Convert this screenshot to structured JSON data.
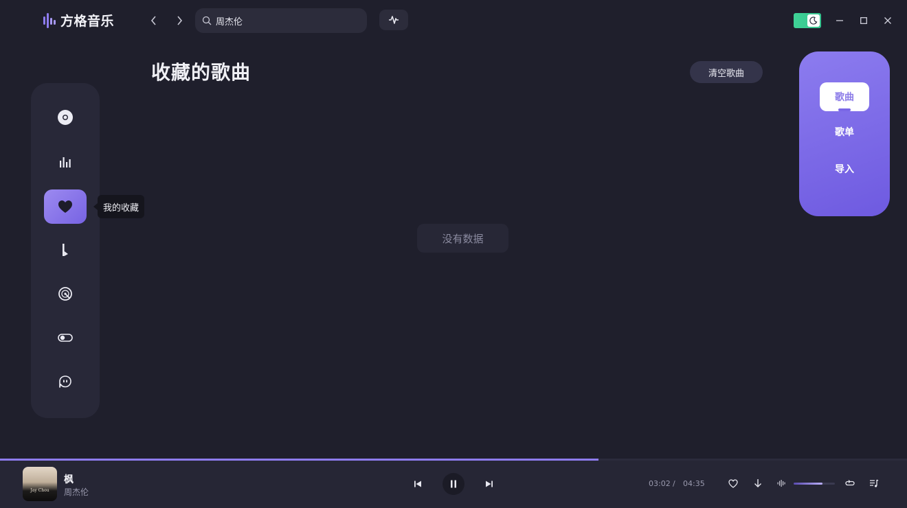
{
  "app": {
    "name": "方格音乐"
  },
  "search": {
    "value": "周杰伦",
    "placeholder": ""
  },
  "theme": {
    "mode": "dark"
  },
  "sidebar": {
    "items": [
      {
        "icon": "disc-icon"
      },
      {
        "icon": "chart-icon"
      },
      {
        "icon": "heart-icon",
        "active": true
      },
      {
        "icon": "music-note-icon"
      },
      {
        "icon": "record-icon"
      },
      {
        "icon": "toggle-icon"
      },
      {
        "icon": "feedback-icon"
      }
    ],
    "tooltip": "我的收藏"
  },
  "main": {
    "title": "收藏的歌曲",
    "clear_button": "清空歌曲",
    "empty_text": "没有数据"
  },
  "tabs": [
    {
      "label": "歌曲",
      "active": true
    },
    {
      "label": "歌单"
    },
    {
      "label": "导入"
    }
  ],
  "player": {
    "title": "枫",
    "artist": "周杰伦",
    "cover_text": "Jay Chou",
    "current_time": "03:02",
    "separator": "/",
    "total_time": "04:35",
    "progress": 0.66,
    "volume": 0.7
  },
  "colors": {
    "accent": "#8e7cf0",
    "background": "#1f1f2c",
    "toggle": "#3fd296"
  }
}
